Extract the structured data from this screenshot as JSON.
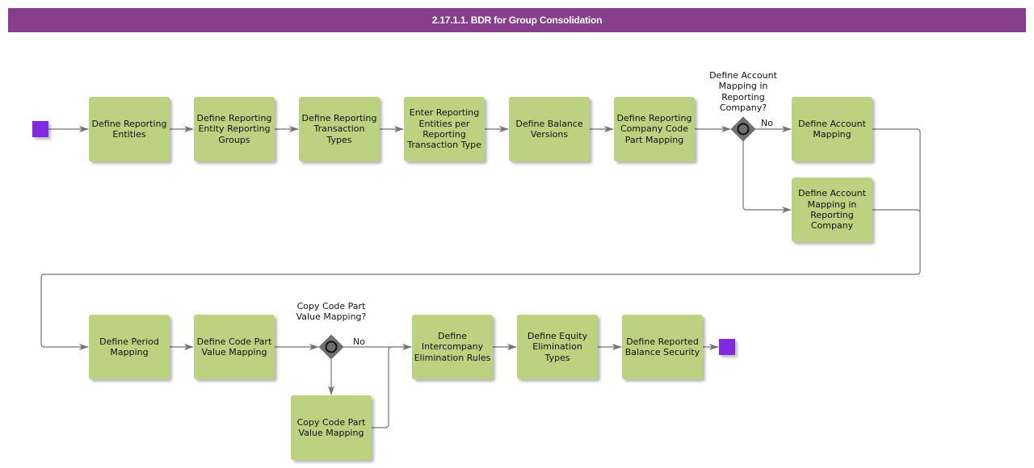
{
  "header": {
    "title": "2.17.1.1. BDR for Group Consolidation"
  },
  "colors": {
    "title_bar": "#873f8b",
    "task_fill": "#bdd280",
    "event_fill": "#8129e0",
    "gateway_fill": "#6f6f6f",
    "connector": "#757575"
  },
  "events": {
    "start": "start-event",
    "end": "end-event"
  },
  "tasks": [
    {
      "id": "t1",
      "label": "Define Reporting Entities"
    },
    {
      "id": "t2",
      "label": "Define Reporting Entity Reporting Groups"
    },
    {
      "id": "t3",
      "label": "Define Reporting Transaction Types"
    },
    {
      "id": "t4",
      "label": "Enter Reporting Entities per Reporting Transaction Type"
    },
    {
      "id": "t5",
      "label": "Define Balance Versions"
    },
    {
      "id": "t6",
      "label": "Define Reporting Company Code Part Mapping"
    },
    {
      "id": "t7",
      "label": "Define Account Mapping"
    },
    {
      "id": "t8",
      "label": "Define Account Mapping in Reporting Company"
    },
    {
      "id": "t9",
      "label": "Define Period Mapping"
    },
    {
      "id": "t10",
      "label": "Define Code Part Value Mapping"
    },
    {
      "id": "t11",
      "label": "Copy Code Part Value Mapping"
    },
    {
      "id": "t12",
      "label": "Define Intercompany Elimination Rules"
    },
    {
      "id": "t13",
      "label": "Define Equity Elimination Types"
    },
    {
      "id": "t14",
      "label": "Define Reported Balance Security"
    }
  ],
  "gateways": [
    {
      "id": "g1",
      "question": "Define Account Mapping in Reporting Company?",
      "no_label": "No"
    },
    {
      "id": "g2",
      "question": "Copy Code Part Value Mapping?",
      "no_label": "No"
    }
  ]
}
